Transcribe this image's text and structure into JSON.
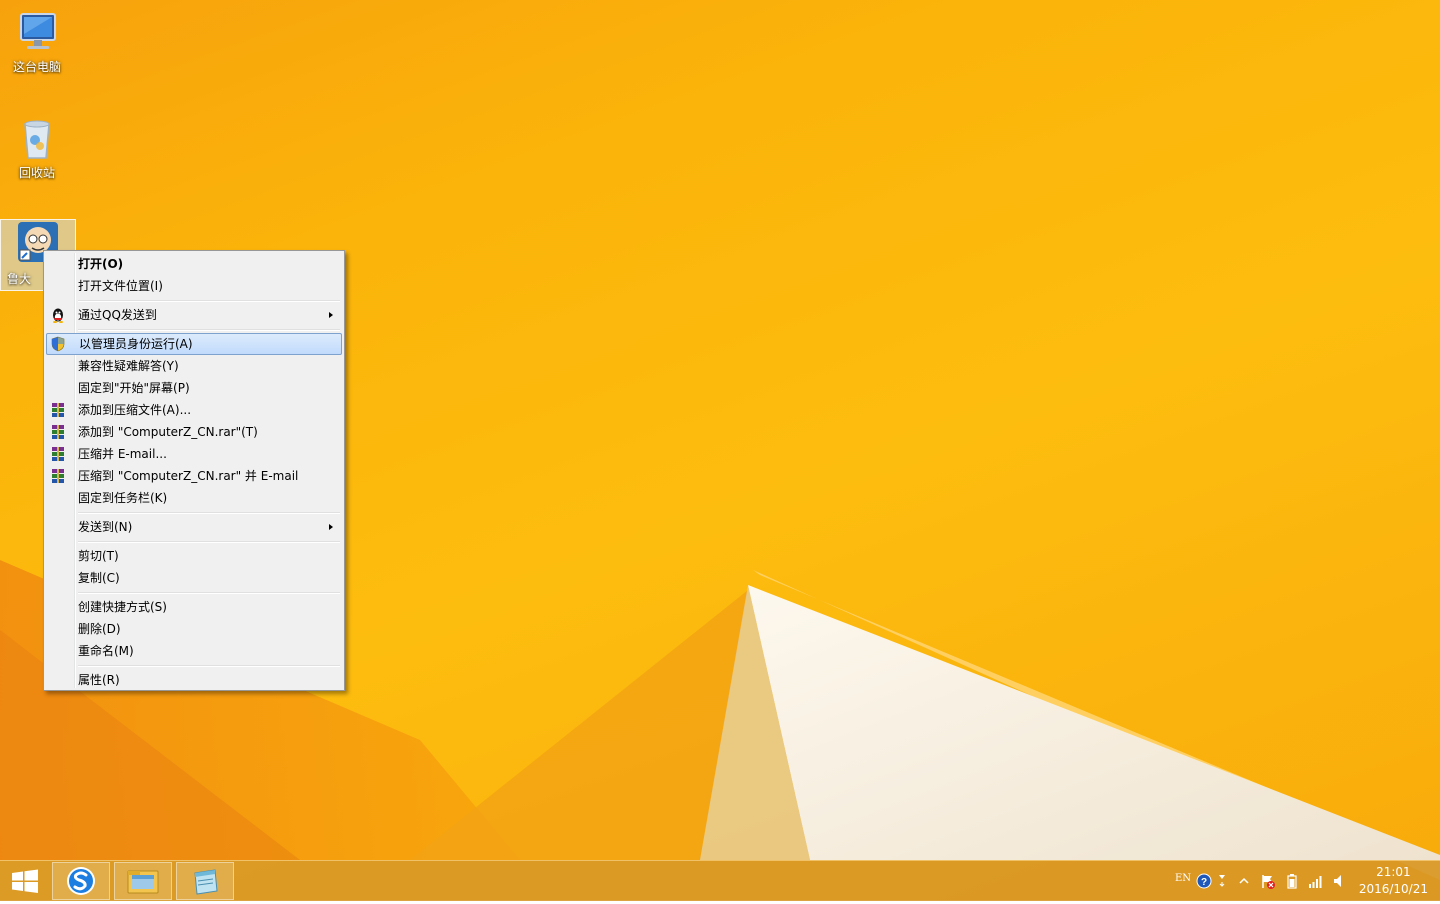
{
  "desktop": {
    "icons": [
      {
        "label": "这台电脑"
      },
      {
        "label": "回收站"
      },
      {
        "label": "鲁大"
      }
    ]
  },
  "context_menu": {
    "items": [
      {
        "label": "打开(O)"
      },
      {
        "label": "打开文件位置(I)"
      },
      {
        "label": "通过QQ发送到"
      },
      {
        "label": "以管理员身份运行(A)"
      },
      {
        "label": "兼容性疑难解答(Y)"
      },
      {
        "label": "固定到\"开始\"屏幕(P)"
      },
      {
        "label": "添加到压缩文件(A)..."
      },
      {
        "label": "添加到 \"ComputerZ_CN.rar\"(T)"
      },
      {
        "label": "压缩并 E-mail..."
      },
      {
        "label": "压缩到 \"ComputerZ_CN.rar\" 并 E-mail"
      },
      {
        "label": "固定到任务栏(K)"
      },
      {
        "label": "发送到(N)"
      },
      {
        "label": "剪切(T)"
      },
      {
        "label": "复制(C)"
      },
      {
        "label": "创建快捷方式(S)"
      },
      {
        "label": "删除(D)"
      },
      {
        "label": "重命名(M)"
      },
      {
        "label": "属性(R)"
      }
    ],
    "highlight_color": "#c1dbfc"
  },
  "taskbar": {
    "buttons": [
      {
        "icon": "windows-logo-icon"
      },
      {
        "icon": "sogou-browser-icon"
      },
      {
        "icon": "file-explorer-icon"
      },
      {
        "icon": "notepad-icon"
      }
    ],
    "tray": {
      "language": "EN",
      "time": "21:01",
      "date": "2016/10/21"
    }
  },
  "colors": {
    "wallpaper": "#fbb40a",
    "taskbar": "#d69628",
    "menu_bg": "#f0f0f0"
  }
}
